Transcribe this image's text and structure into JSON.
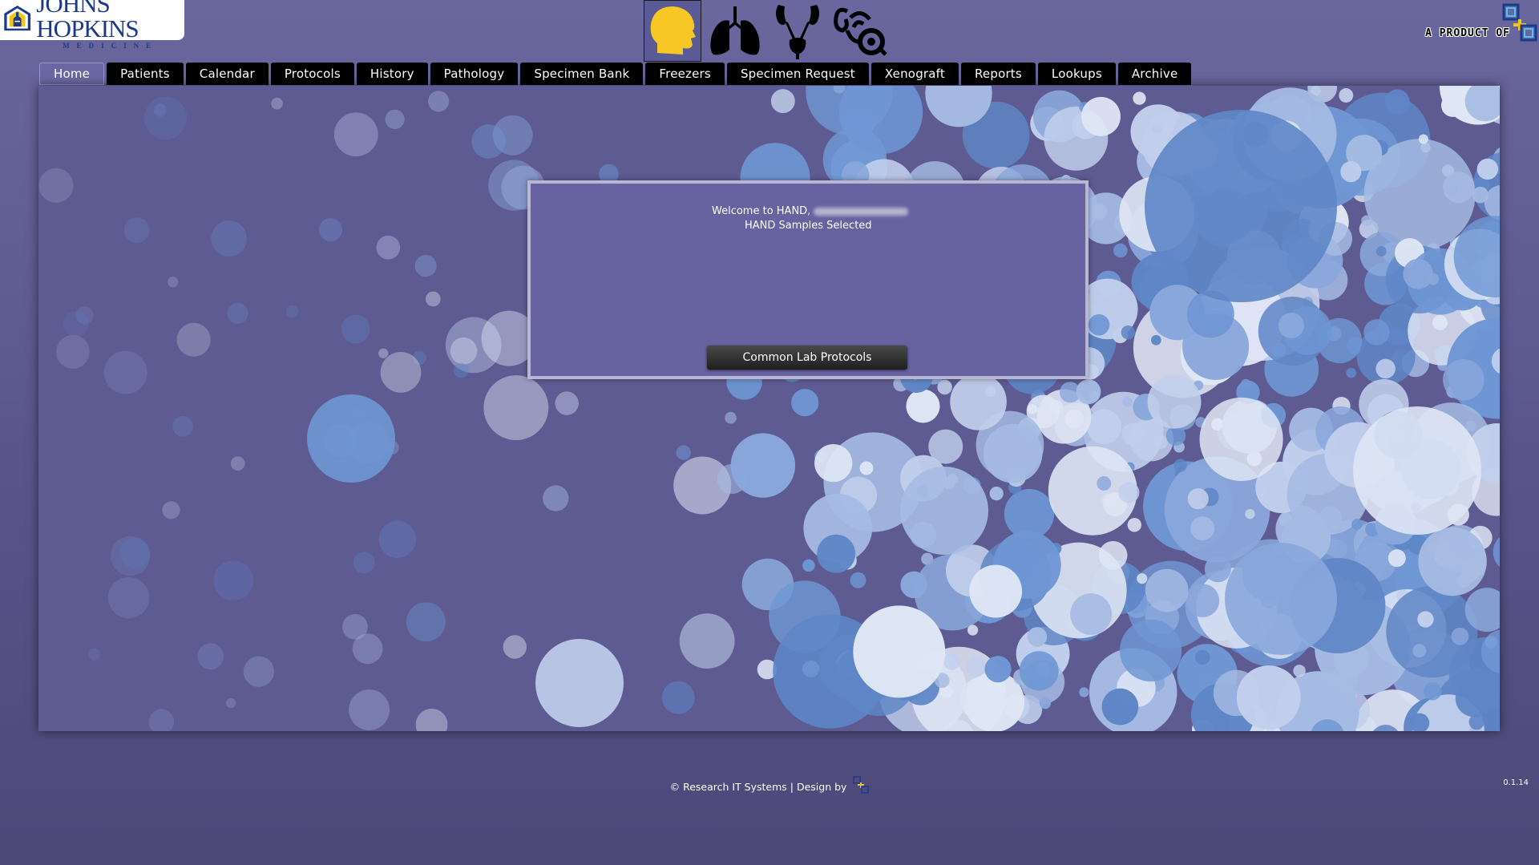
{
  "header": {
    "logo_name": "JOHNS HOPKINS",
    "logo_sub": "MEDICINE",
    "product_label": "A PRODUCT OF",
    "organs": [
      {
        "name": "head-icon",
        "selected": true
      },
      {
        "name": "lungs-icon",
        "selected": false
      },
      {
        "name": "kidney-icon",
        "selected": false
      },
      {
        "name": "ear-icon",
        "selected": false
      }
    ]
  },
  "nav": {
    "tabs": [
      "Home",
      "Patients",
      "Calendar",
      "Protocols",
      "History",
      "Pathology",
      "Specimen Bank",
      "Freezers",
      "Specimen Request",
      "Xenograft",
      "Reports",
      "Lookups",
      "Archive"
    ],
    "active": "Home"
  },
  "welcome": {
    "greeting": "Welcome to HAND,",
    "samples": "HAND Samples Selected",
    "button": "Common Lab Protocols"
  },
  "footer": {
    "copyright": "© Research IT Systems | Design by",
    "version": "0.1.14"
  },
  "colors": {
    "background": "#5e5a92",
    "tab": "#000000",
    "active_tab": "#6b67a3",
    "bubble": "#6a94d0",
    "accent_yellow": "#f7c825"
  }
}
